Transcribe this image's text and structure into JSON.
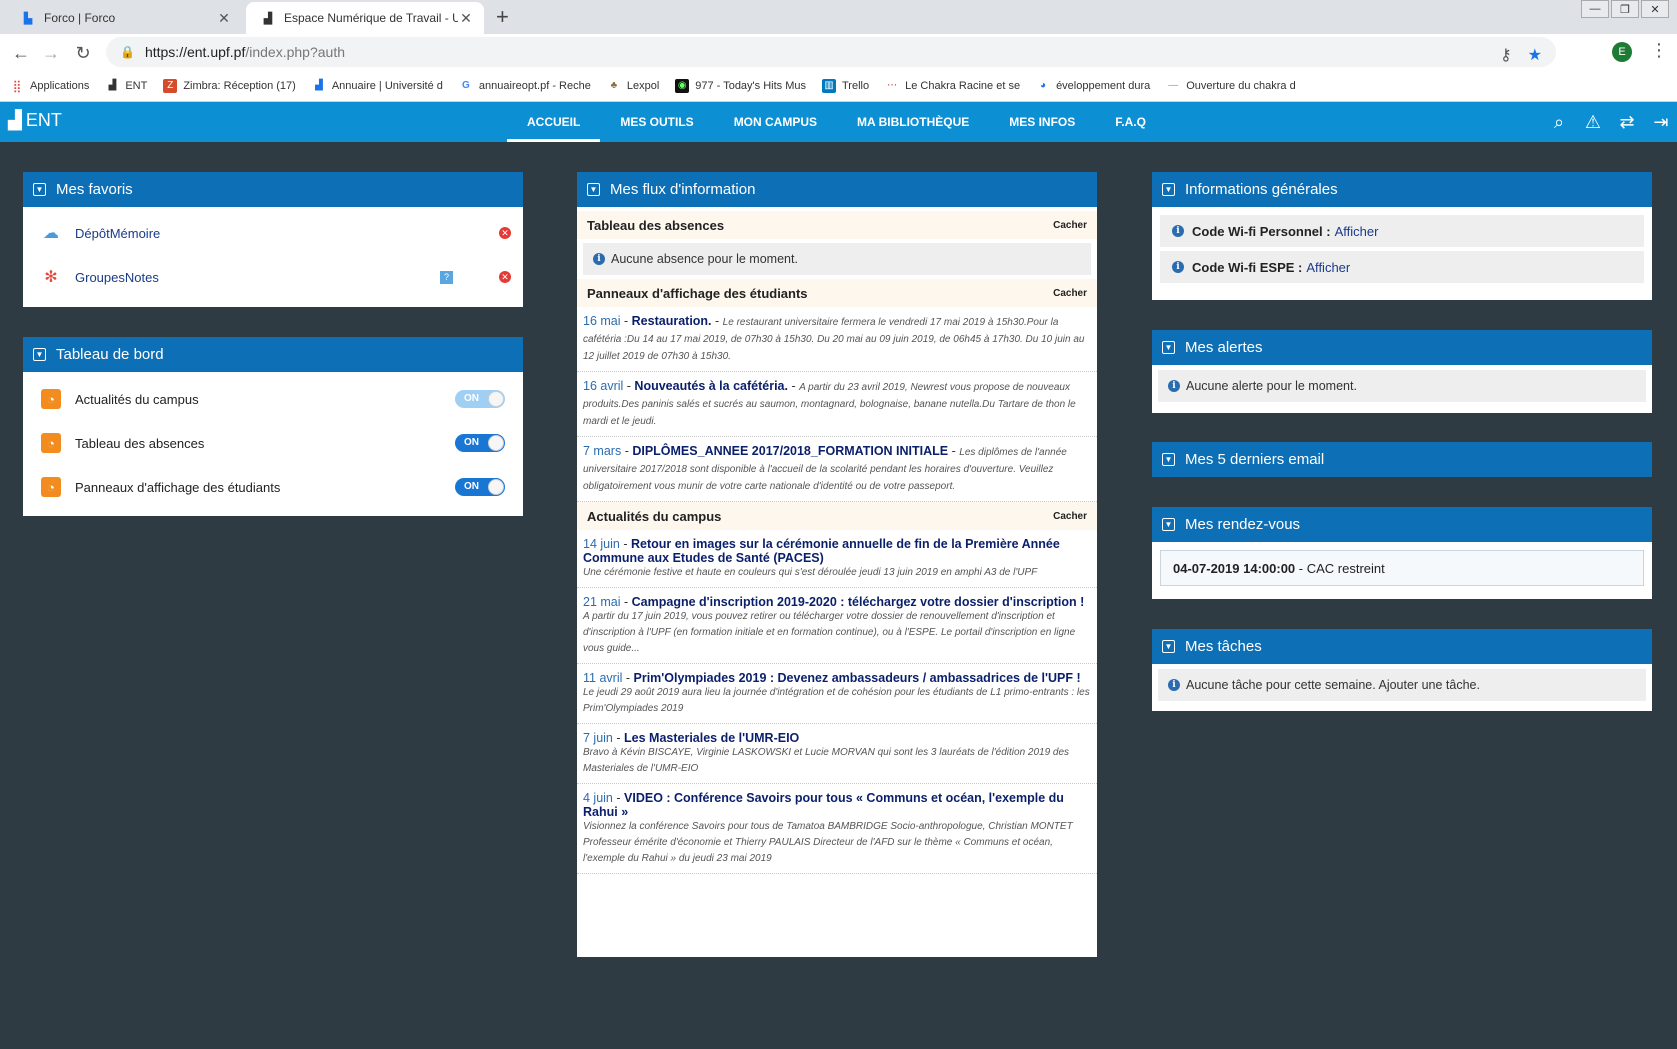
{
  "browser": {
    "tabs": [
      {
        "title": "Forco | Forco",
        "active": false
      },
      {
        "title": "Espace Numérique de Travail - Univ",
        "active": true
      }
    ],
    "url_host": "https://ent.upf.pf",
    "url_path": "/index.php?auth",
    "profile_initial": "E",
    "bookmarks": [
      {
        "label": "Applications",
        "icon": "apps-grid-icon"
      },
      {
        "label": "ENT",
        "icon": "ent-logo-icon"
      },
      {
        "label": "Zimbra: Réception (17)",
        "icon": "zimbra-icon"
      },
      {
        "label": "Annuaire | Université d",
        "icon": "ent-logo-icon"
      },
      {
        "label": "annuaireopt.pf - Reche",
        "icon": "google-icon"
      },
      {
        "label": "Lexpol",
        "icon": "lexpol-icon"
      },
      {
        "label": "977 - Today's Hits Mus",
        "icon": "radio-icon"
      },
      {
        "label": "Trello",
        "icon": "trello-icon"
      },
      {
        "label": "Le Chakra Racine et se",
        "icon": "page-icon"
      },
      {
        "label": "éveloppement dura",
        "icon": "globe-icon"
      },
      {
        "label": "Ouverture du chakra d",
        "icon": "page-icon"
      }
    ]
  },
  "ent": {
    "logo_text": "ENT",
    "menu": [
      {
        "label": "ACCUEIL",
        "active": true
      },
      {
        "label": "MES OUTILS",
        "active": false
      },
      {
        "label": "MON CAMPUS",
        "active": false
      },
      {
        "label": "MA BIBLIOTHÈQUE",
        "active": false
      },
      {
        "label": "MES INFOS",
        "active": false
      },
      {
        "label": "F.A.Q",
        "active": false
      }
    ]
  },
  "favoris": {
    "title": "Mes favoris",
    "items": [
      {
        "label": "DépôtMémoire",
        "icon": "cloud-upload-icon"
      },
      {
        "label": "GroupesNotes",
        "icon": "pinwheel-icon"
      }
    ]
  },
  "tableau": {
    "title": "Tableau de bord",
    "items": [
      {
        "label": "Actualités du campus",
        "state": "ON"
      },
      {
        "label": "Tableau des absences",
        "state": "ON"
      },
      {
        "label": "Panneaux d'affichage des étudiants",
        "state": "ON"
      }
    ]
  },
  "flux": {
    "title": "Mes flux d'information",
    "hide_label": "Cacher",
    "sections": {
      "absences": {
        "title": "Tableau des absences",
        "notice": "Aucune absence pour le moment."
      },
      "panneaux": {
        "title": "Panneaux d'affichage des étudiants",
        "news": [
          {
            "date": "16 mai",
            "title": "Restauration.",
            "desc": "Le restaurant universitaire fermera le vendredi 17 mai 2019 à 15h30.Pour la cafétéria :Du 14 au 17 mai 2019, de 07h30 à 15h30. Du 20 mai au 09 juin 2019, de 06h45 à 17h30. Du 10 juin au 12 juillet 2019 de 07h30 à 15h30."
          },
          {
            "date": "16 avril",
            "title": "Nouveautés à la cafétéria.",
            "desc": "A partir du 23 avril 2019, Newrest vous propose de nouveaux produits.Des paninis salés et sucrés au saumon, montagnard, bolognaise, banane nutella.Du Tartare de thon le mardi et le jeudi."
          },
          {
            "date": "7 mars",
            "title": "DIPLÔMES_ANNEE 2017/2018_FORMATION INITIALE",
            "desc": "Les diplômes de l'année universitaire 2017/2018 sont disponible à l'accueil de la scolarité pendant les horaires d'ouverture. Veuillez obligatoirement vous munir de votre carte nationale d'identité ou de votre passeport."
          }
        ]
      },
      "actualites": {
        "title": "Actualités du campus",
        "news": [
          {
            "date": "14 juin",
            "title": "Retour en images sur la cérémonie annuelle de fin de la Première Année Commune aux Etudes de Santé (PACES)",
            "desc": "Une cérémonie festive et haute en couleurs qui s'est déroulée jeudi 13 juin 2019 en amphi A3 de l'UPF"
          },
          {
            "date": "21 mai",
            "title": "Campagne d'inscription 2019-2020 : téléchargez votre dossier d'inscription !",
            "desc": "A partir du 17 juin 2019, vous pouvez retirer ou télécharger votre dossier de renouvellement d'inscription et d'inscription à l'UPF (en formation initiale et en formation continue), ou à l'ESPE. Le portail d'inscription en ligne vous guide..."
          },
          {
            "date": "11 avril",
            "title": "Prim'Olympiades 2019 : Devenez ambassadeurs / ambassadrices de l'UPF !",
            "desc": "Le jeudi 29 août 2019 aura lieu la journée d'intégration et de cohésion pour les étudiants de L1 primo-entrants : les Prim'Olympiades 2019"
          },
          {
            "date": "7 juin",
            "title": "Les Masteriales de l'UMR-EIO",
            "desc": "Bravo à Kévin BISCAYE, Virginie LASKOWSKI et Lucie MORVAN qui sont les 3 lauréats de l'édition 2019 des Masteriales de l'UMR-EIO"
          },
          {
            "date": "4 juin",
            "title": "VIDEO : Conférence Savoirs pour tous « Communs et océan, l'exemple du Rahui »",
            "desc": "Visionnez la conférence Savoirs pour tous de Tamatoa BAMBRIDGE Socio-anthropologue, Christian MONTET Professeur émérite d'économie et Thierry PAULAIS Directeur de l'AFD sur le thème « Communs et océan, l'exemple du Rahui » du jeudi 23 mai 2019"
          }
        ]
      }
    }
  },
  "infos": {
    "title": "Informations générales",
    "rows": [
      {
        "label": "Code Wi-fi Personnel :",
        "link": "Afficher"
      },
      {
        "label": "Code Wi-fi ESPE :",
        "link": "Afficher"
      }
    ]
  },
  "alertes": {
    "title": "Mes alertes",
    "notice": "Aucune alerte pour le moment."
  },
  "emails": {
    "title": "Mes 5 derniers email"
  },
  "rdv": {
    "title": "Mes rendez-vous",
    "datetime": "04-07-2019 14:00:00",
    "label": " - CAC restreint"
  },
  "taches": {
    "title": "Mes tâches",
    "notice": "Aucune tâche pour cette semaine. Ajouter une tâche."
  },
  "colors": {
    "nav": "#0d8fd3",
    "panel_head": "#0d6fb5",
    "background": "#2f3b42",
    "rss": "#f28c1e",
    "toggle_on": "#1976d2"
  }
}
